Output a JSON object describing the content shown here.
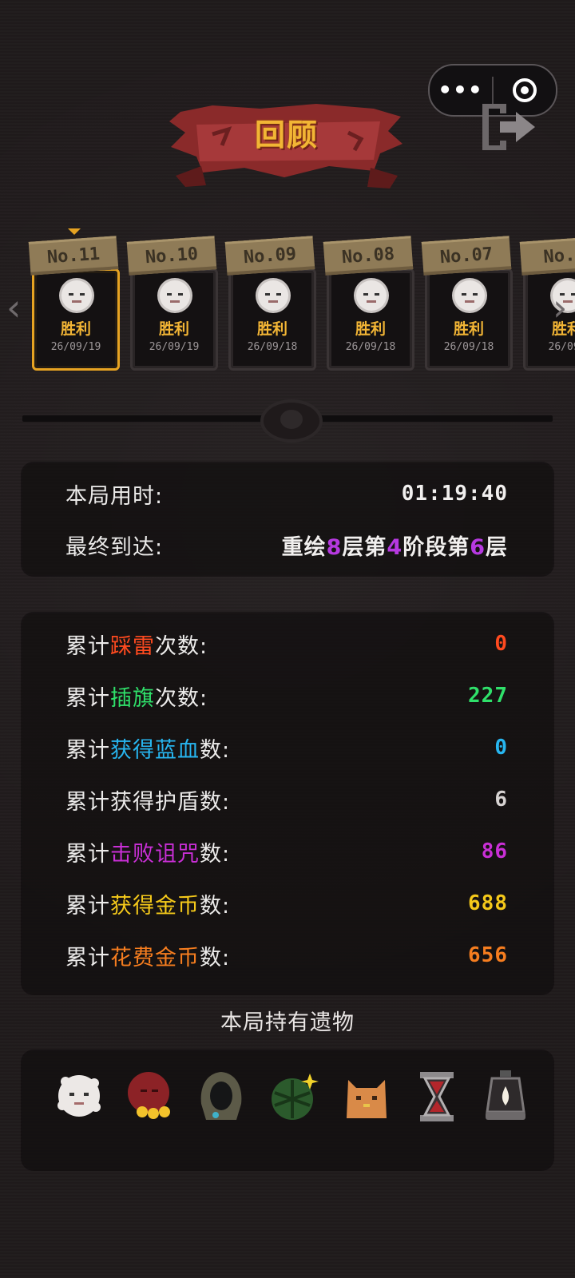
{
  "capsule": {
    "more_icon": "more-dots-icon",
    "close_icon": "target-circle-icon"
  },
  "header": {
    "title": "回顾",
    "exit_icon": "exit-door-icon"
  },
  "history": {
    "cards": [
      {
        "number": "No.11",
        "result": "胜利",
        "date": "26/09/19",
        "selected": true
      },
      {
        "number": "No.10",
        "result": "胜利",
        "date": "26/09/19",
        "selected": false
      },
      {
        "number": "No.09",
        "result": "胜利",
        "date": "26/09/18",
        "selected": false
      },
      {
        "number": "No.08",
        "result": "胜利",
        "date": "26/09/18",
        "selected": false
      },
      {
        "number": "No.07",
        "result": "胜利",
        "date": "26/09/18",
        "selected": false
      },
      {
        "number": "No.0",
        "result": "胜利",
        "date": "26/09/",
        "selected": false
      }
    ]
  },
  "summary": {
    "time_label": "本局用时:",
    "time_value": "01:19:40",
    "reach_label": "最终到达:",
    "reach_parts": [
      "重绘",
      "8",
      "层第",
      "4",
      "阶段第",
      "6",
      "层"
    ]
  },
  "stats": [
    {
      "prefix": "累计",
      "highlight": "踩雷",
      "suffix": "次数:",
      "value": "0",
      "color": "#ff4a1f"
    },
    {
      "prefix": "累计",
      "highlight": "插旗",
      "suffix": "次数:",
      "value": "227",
      "color": "#2fe06a"
    },
    {
      "prefix": "累计",
      "highlight": "获得蓝血",
      "suffix": "数:",
      "value": "0",
      "color": "#27b6f0"
    },
    {
      "prefix": "累计",
      "highlight": "获得护盾",
      "suffix": "数:",
      "value": "6",
      "color": "#d7d3d2"
    },
    {
      "prefix": "累计",
      "highlight": "击败诅咒",
      "suffix": "数:",
      "value": "86",
      "color": "#c92fd6"
    },
    {
      "prefix": "累计",
      "highlight": "获得金币",
      "suffix": "数:",
      "value": "688",
      "color": "#f5c91a"
    },
    {
      "prefix": "累计",
      "highlight": "花费金币",
      "suffix": "数:",
      "value": "656",
      "color": "#f57d1f"
    }
  ],
  "relics": {
    "title": "本局持有遗物",
    "items": [
      "white-spirit-icon",
      "red-coin-blob-icon",
      "hooded-cloak-icon",
      "green-shell-icon",
      "orange-cat-icon",
      "hourglass-icon",
      "lantern-icon"
    ]
  }
}
